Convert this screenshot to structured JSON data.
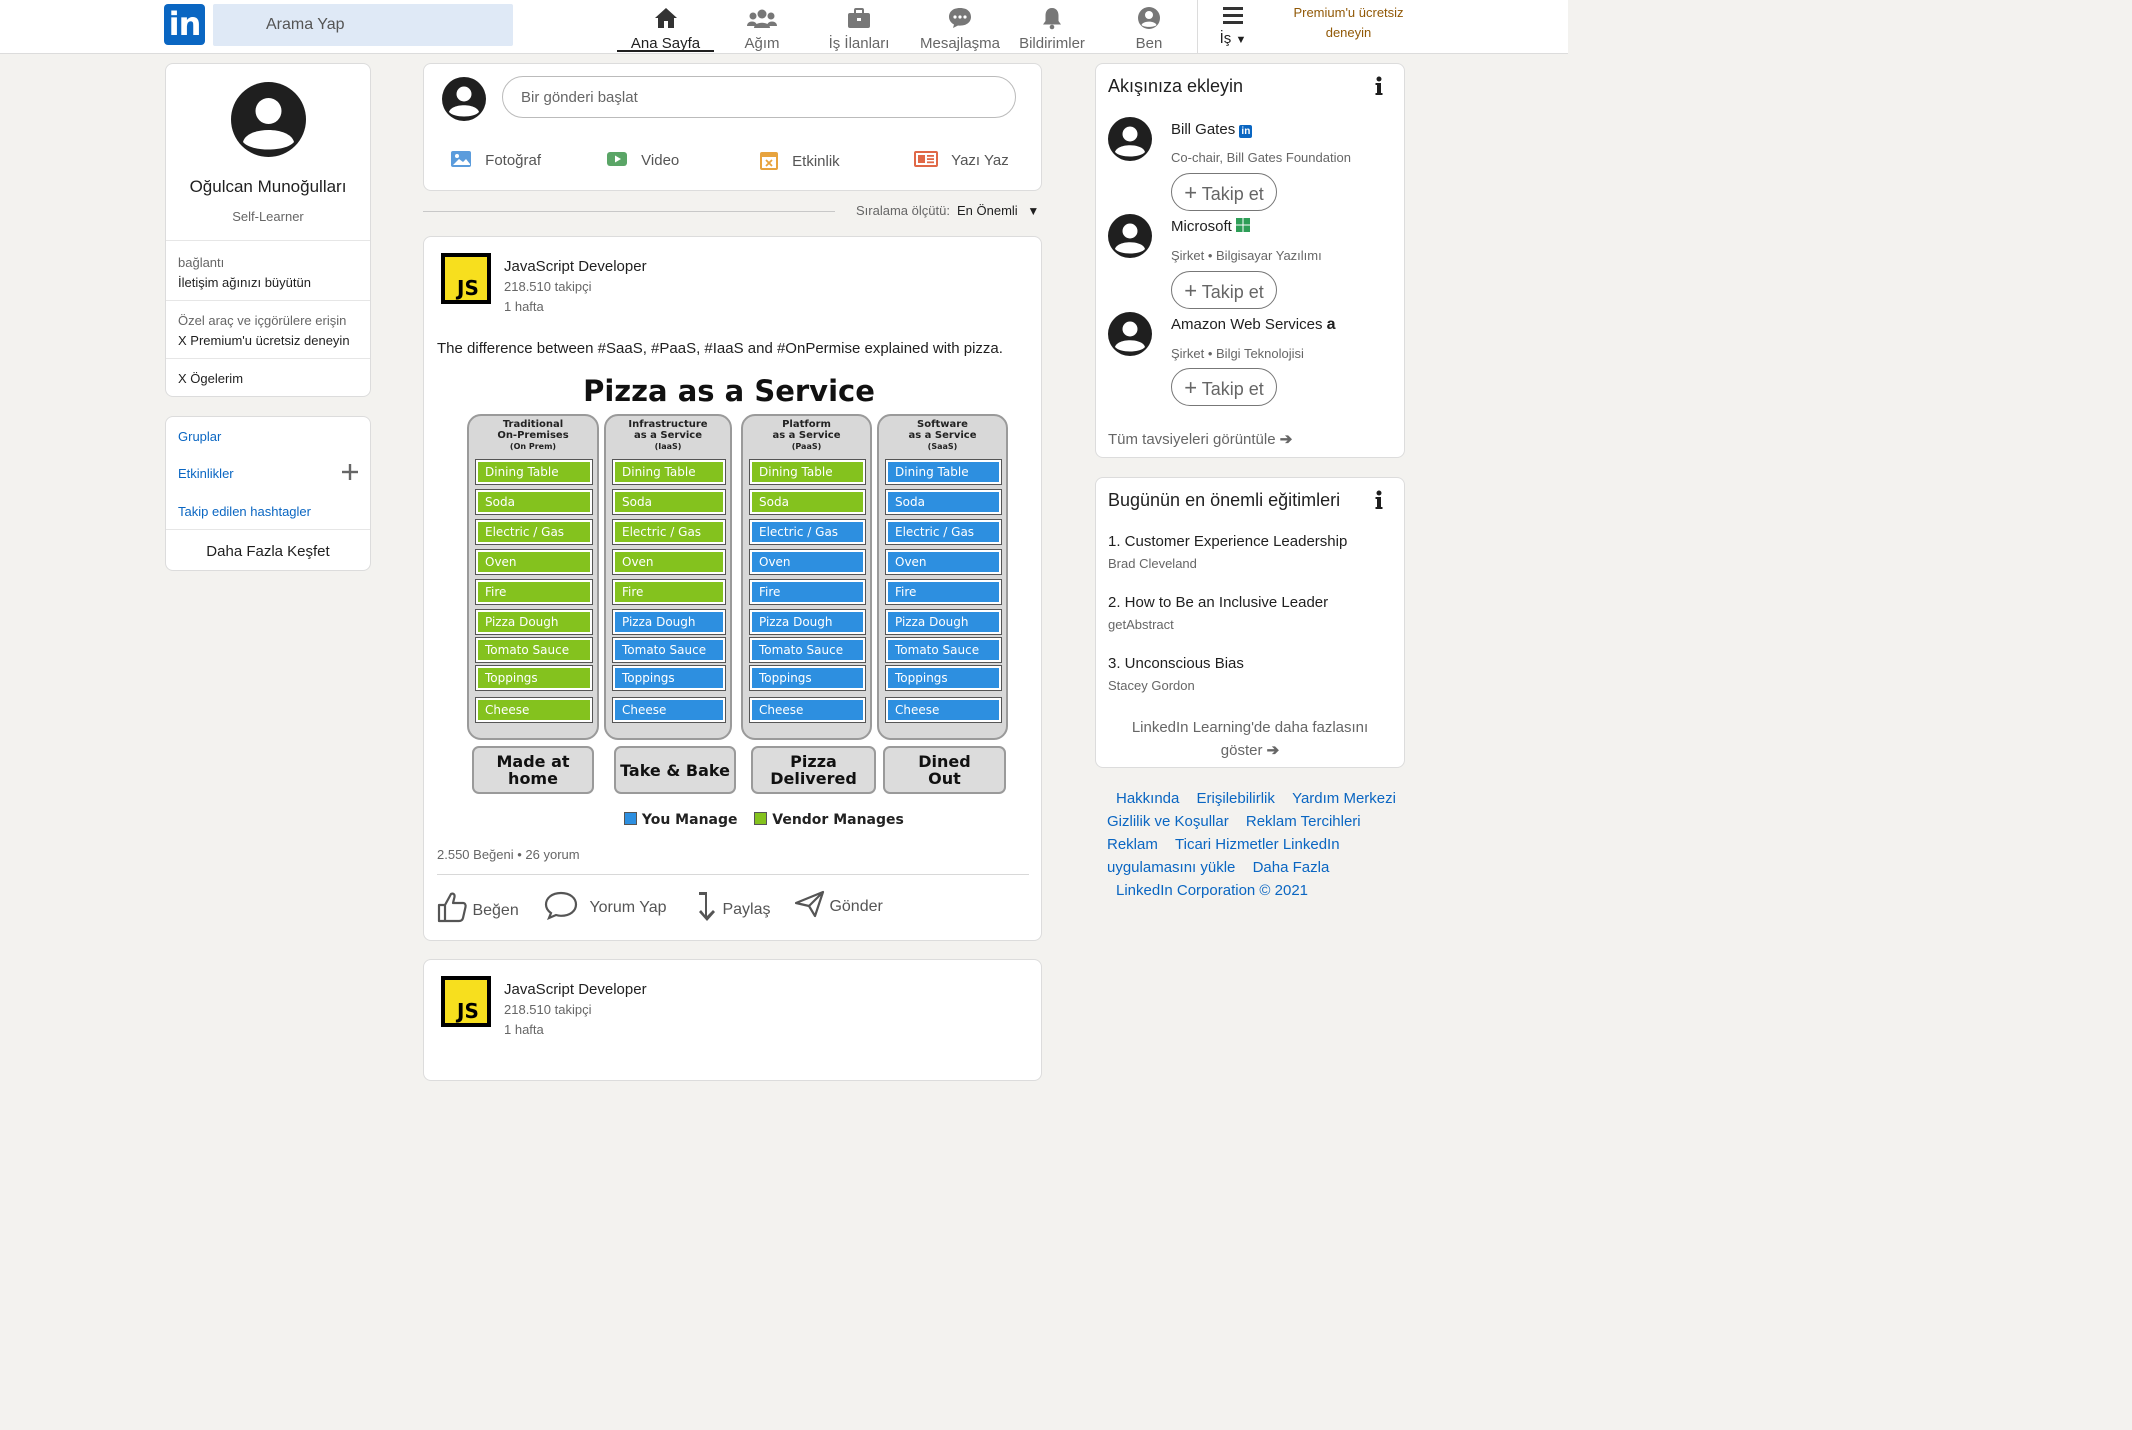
{
  "header": {
    "logo_text": "in",
    "search_placeholder": "Arama Yap",
    "nav": [
      {
        "label": "Ana Sayfa",
        "icon": "home-icon",
        "active": true
      },
      {
        "label": "Ağım",
        "icon": "network-icon"
      },
      {
        "label": "İş İlanları",
        "icon": "briefcase-icon"
      },
      {
        "label": "Mesajlaşma",
        "icon": "messaging-icon"
      },
      {
        "label": "Bildirimler",
        "icon": "bell-icon"
      },
      {
        "label": "Ben",
        "icon": "user-icon"
      },
      {
        "label": "İş",
        "icon": "menu-icon"
      }
    ],
    "premium_line1": "Premium'u ücretsiz",
    "premium_line2": "deneyin"
  },
  "profile": {
    "name": "Oğulcan Munoğulları",
    "headline": "Self-Learner",
    "connection_label": "bağlantı",
    "connection_text": "İletişim ağınızı büyütün",
    "premium_hint": "Özel araç ve içgörülere erişin",
    "premium_cta": "X Premium'u ücretsiz deneyin",
    "my_items": "X Ögelerim"
  },
  "groups": {
    "groups_label": "Gruplar",
    "events_label": "Etkinlikler",
    "hashtags_label": "Takip edilen hashtagler",
    "discover_label": "Daha Fazla Keşfet"
  },
  "composer": {
    "placeholder": "Bir gönderi başlat",
    "actions": [
      "Fotoğraf",
      "Video",
      "Etkinlik",
      "Yazı Yaz"
    ]
  },
  "sort": {
    "label": "Sıralama ölçütü:",
    "value": "En Önemli"
  },
  "post": {
    "author": "JavaScript Developer",
    "followers": "218.510 takipçi",
    "time": "1 hafta",
    "logo_text": "JS",
    "text": "The difference between #SaaS, #PaaS, #IaaS and #OnPermise explained with pizza.",
    "stats": "2.550 Beğeni • 26 yorum",
    "actions": [
      "Beğen",
      "Yorum Yap",
      "Paylaş",
      "Gönder"
    ]
  },
  "pizza_chart": {
    "title": "Pizza as a Service",
    "columns": [
      {
        "header": [
          "Traditional",
          "On-Premises",
          "(On Prem)"
        ],
        "footer": [
          "Made at",
          "home"
        ],
        "vendor_from": 9
      },
      {
        "header": [
          "Infrastructure",
          "as a Service",
          "(IaaS)"
        ],
        "footer": [
          "Take & Bake"
        ],
        "vendor_from": 5
      },
      {
        "header": [
          "Platform",
          "as a Service",
          "(PaaS)"
        ],
        "footer": [
          "Pizza",
          "Delivered"
        ],
        "vendor_from": 2
      },
      {
        "header": [
          "Software",
          "as a Service",
          "(SaaS)"
        ],
        "footer": [
          "Dined",
          "Out"
        ],
        "vendor_from": 0
      }
    ],
    "items": [
      "Dining Table",
      "Soda",
      "Electric / Gas",
      "Oven",
      "Fire",
      "Pizza Dough",
      "Tomato Sauce",
      "Toppings",
      "Cheese"
    ],
    "legend": [
      "You Manage",
      "Vendor Manages"
    ],
    "colors": {
      "you_manage": "#2d8fe0",
      "vendor_manages": "#84c21e"
    }
  },
  "post2": {
    "author": "JavaScript Developer",
    "followers": "218.510 takipçi",
    "time": "1 hafta",
    "logo_text": "JS"
  },
  "follow_card": {
    "title": "Akışınıza ekleyin",
    "items": [
      {
        "name": "Bill Gates",
        "subtitle": "Co-chair, Bill Gates Foundation",
        "button": "Takip et"
      },
      {
        "name": "Microsoft",
        "subtitle": "Şirket • Bilgisayar Yazılımı",
        "button": "Takip et"
      },
      {
        "name": "Amazon Web Services",
        "subtitle": "Şirket • Bilgi Teknolojisi",
        "button": "Takip et"
      }
    ],
    "view_all": "Tüm tavsiyeleri görüntüle"
  },
  "learning": {
    "title": "Bugünün en önemli eğitimleri",
    "courses": [
      {
        "title": "1. Customer Experience Leadership",
        "author": "Brad Cleveland"
      },
      {
        "title": "2. How to Be an Inclusive Leader",
        "author": "getAbstract"
      },
      {
        "title": "3. Unconscious Bias",
        "author": "Stacey Gordon"
      }
    ],
    "more_line1": "LinkedIn Learning'de daha fazlasını",
    "more_line2": "göster"
  },
  "footer": {
    "links": [
      "Hakkında",
      "Erişilebilirlik",
      "Yardım Merkezi",
      "Gizlilik ve Koşullar",
      "Reklam Tercihleri",
      "Reklam",
      "Ticari Hizmetler",
      "LinkedIn uygulamasını yükle",
      "Daha Fazla"
    ],
    "copyright": "LinkedIn Corporation © 2021"
  }
}
